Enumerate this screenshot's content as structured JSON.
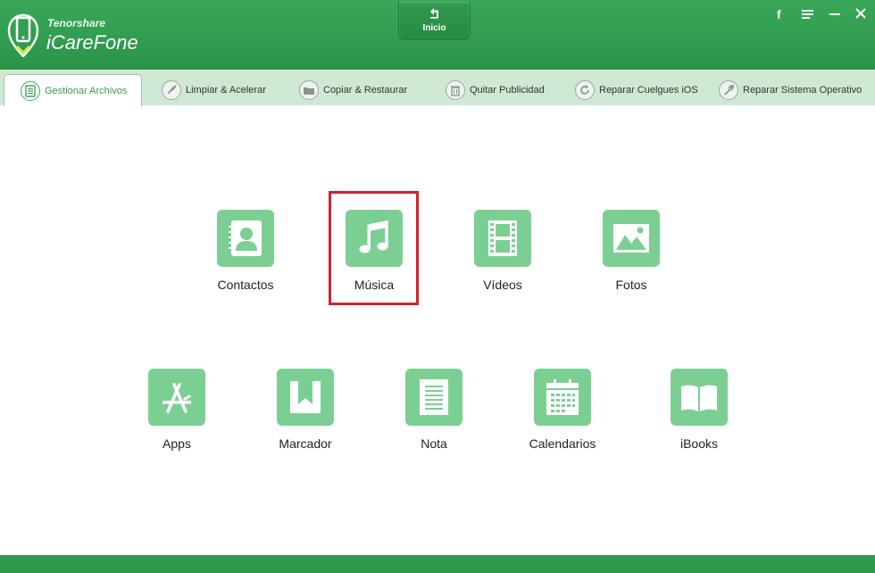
{
  "header": {
    "brand_small": "Tenorshare",
    "brand_name": "iCareFone",
    "home_label": "Inicio",
    "controls": [
      "facebook-icon",
      "menu-icon",
      "minimize-icon",
      "close-icon"
    ]
  },
  "tabs": [
    {
      "label": "Gestionar Archivos",
      "icon": "file-manager-icon",
      "active": true
    },
    {
      "label": "Limpiar & Acelerar",
      "icon": "rocket-icon"
    },
    {
      "label": "Copiar  & Restaurar",
      "icon": "folder-icon"
    },
    {
      "label": "Quitar Publicidad",
      "icon": "trash-icon"
    },
    {
      "label": "Reparar Cuelgues iOS",
      "icon": "refresh-icon"
    },
    {
      "label": "Reparar Sistema Operativo",
      "icon": "wrench-icon"
    }
  ],
  "items": [
    {
      "label": "Contactos",
      "icon": "contacts-icon"
    },
    {
      "label": "Música",
      "icon": "music-icon",
      "highlighted": true
    },
    {
      "label": "Vídeos",
      "icon": "video-icon"
    },
    {
      "label": "Fotos",
      "icon": "photos-icon"
    },
    {
      "label": "Apps",
      "icon": "appstore-icon"
    },
    {
      "label": "Marcador",
      "icon": "bookmark-icon"
    },
    {
      "label": "Nota",
      "icon": "note-icon"
    },
    {
      "label": "Calendarios",
      "icon": "calendar-icon"
    },
    {
      "label": "iBooks",
      "icon": "ibooks-icon"
    }
  ],
  "colors": {
    "brand_green": "#2d9a4b",
    "tile_green": "#7ccf93",
    "highlight_red": "#d1222c"
  }
}
